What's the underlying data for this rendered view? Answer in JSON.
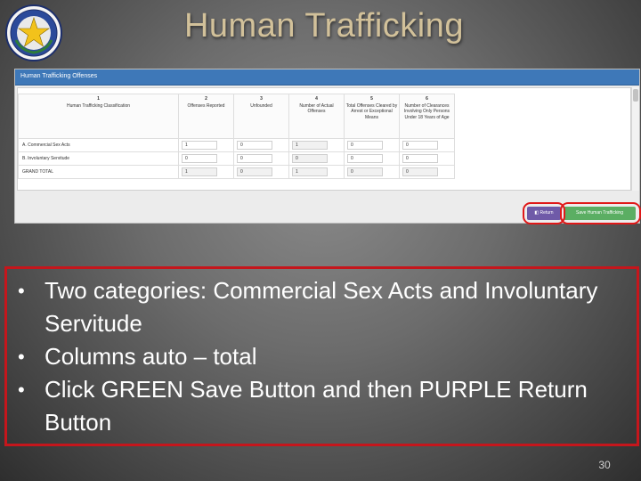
{
  "slide": {
    "title": "Human Trafficking",
    "page_number": "30"
  },
  "screenshot": {
    "panel_title": "Human Trafficking Offenses",
    "columns": [
      {
        "num": "1",
        "label": "Human Trafficking Classification"
      },
      {
        "num": "2",
        "label": "Offenses Reported"
      },
      {
        "num": "3",
        "label": "Unfounded"
      },
      {
        "num": "4",
        "label": "Number of Actual Offenses"
      },
      {
        "num": "5",
        "label": "Total Offenses Cleared by Arrest or Exceptional Means"
      },
      {
        "num": "6",
        "label": "Number of Clearances Involving Only Persons Under 18 Years of Age"
      }
    ],
    "rows": [
      {
        "label": "A. Commercial Sex Acts",
        "values": [
          "1",
          "0",
          "1",
          "0",
          "0"
        ]
      },
      {
        "label": "B. Involuntary Servitude",
        "values": [
          "0",
          "0",
          "0",
          "0",
          "0"
        ]
      },
      {
        "label": "GRAND TOTAL",
        "values": [
          "1",
          "0",
          "1",
          "0",
          "0"
        ]
      }
    ],
    "return_button": "Return",
    "save_button": "Save Human Trafficking",
    "colors": {
      "header_blue": "#3e78b8",
      "return_purple": "#6f5aa8",
      "save_green": "#5bae63",
      "highlight_red": "#e01818"
    }
  },
  "bullets": [
    "Two categories:  Commercial Sex Acts and Involuntary Servitude",
    "Columns auto – total",
    "Click GREEN Save Button and then PURPLE Return Button"
  ]
}
